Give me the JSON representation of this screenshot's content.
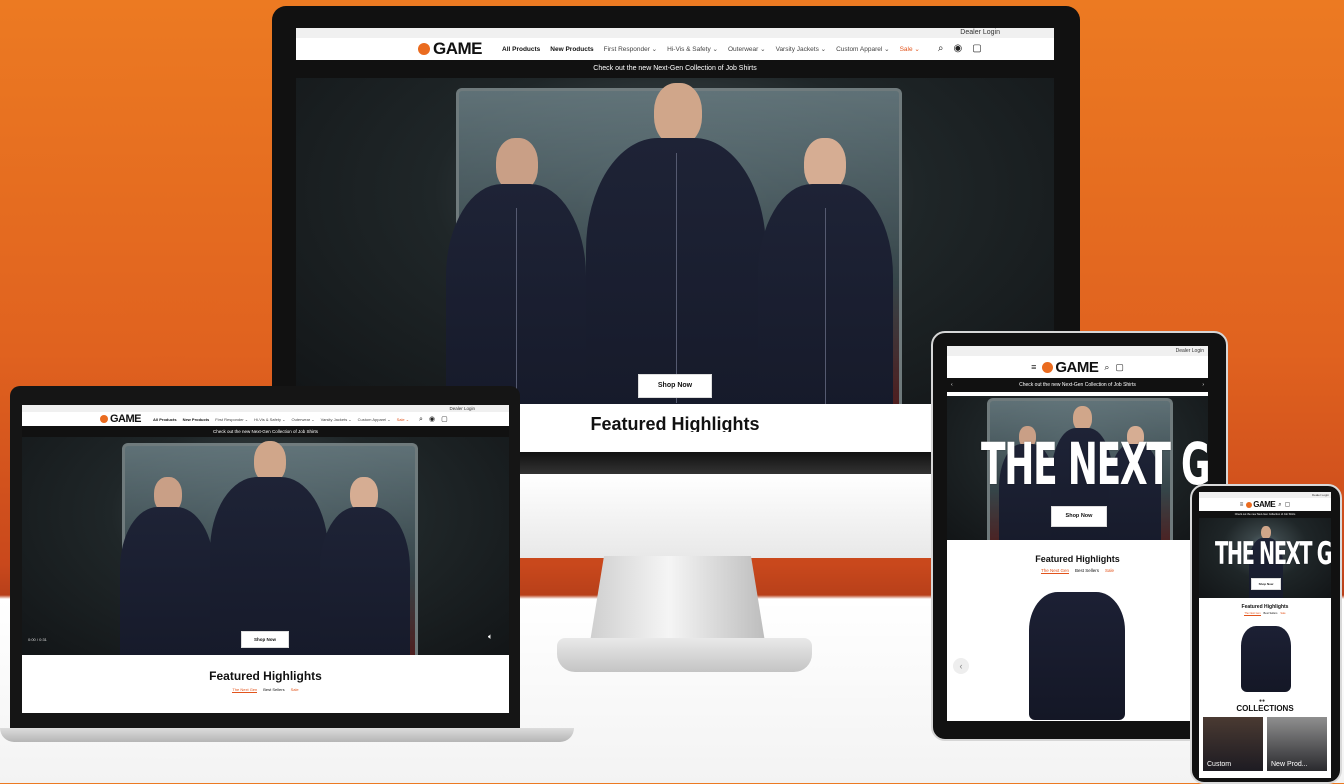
{
  "brand": {
    "logo_text": "GAME",
    "accent": "#ea6b1f",
    "sale_color": "#e2541c"
  },
  "utility": {
    "dealer_login": "Dealer Login"
  },
  "nav": {
    "all_products": "All Products",
    "new_products": "New Products",
    "first_responder": "First Responder ⌄",
    "hivis_safety": "Hi-Vis & Safety ⌄",
    "outerwear": "Outerwear ⌄",
    "varsity_jackets": "Varsity Jackets ⌄",
    "custom_apparel": "Custom Apparel ⌄",
    "sale": "Sale ⌄"
  },
  "announcement": "Check out the new Next-Gen Collection of Job Shirts",
  "hero": {
    "cta": "Shop Now",
    "headline": "THE NEXT GEN",
    "video_time": "0:00 / 0:31"
  },
  "featured": {
    "title": "Featured Highlights",
    "tabs": [
      "The Next Gen",
      "Best Sellers",
      "Sale"
    ]
  },
  "collections": {
    "title": "COLLECTIONS",
    "items": [
      "Custom",
      "New Prod..."
    ]
  },
  "icons": [
    "search-icon",
    "account-icon",
    "cart-icon",
    "menu-icon",
    "volume-icon",
    "chevron-left-icon",
    "chevron-right-icon"
  ]
}
